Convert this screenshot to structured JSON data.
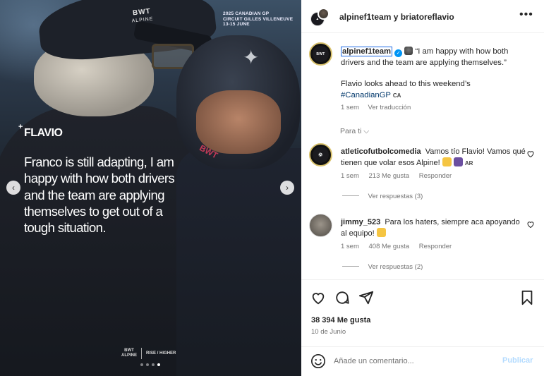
{
  "media": {
    "event_line1": "2025 CANADIAN GP",
    "event_line2": "CIRCUIT GILLES VILLENEUVE",
    "event_line3": "13-15 JUNE",
    "cap_brand": "BWT",
    "cap_team": "ALPINE",
    "sleeve_text": "BWT",
    "tag_label": "FLAVIO",
    "quote": "Franco is still adapting, I am happy with how both drivers and the team are applying themselves to get out of a tough situation.",
    "footer_brand": "BWT",
    "footer_team": "ALPINE",
    "footer_motto": "RISE / HIGHER",
    "prev_icon": "chevron-left-icon",
    "next_icon": "chevron-right-icon",
    "slide_count": 4,
    "active_slide": 4
  },
  "header": {
    "title": "alpinef1team y briatoreflavio",
    "more_icon": "more-horizontal-icon"
  },
  "caption": {
    "username": "alpinef1team",
    "text_line1": "“I am happy with how both drivers and the team are applying themselves.”",
    "text_line2": "Flavio looks ahead to this weekend’s",
    "hashtag": "#CanadianGP",
    "flag": "CA",
    "time": "1 sem",
    "translate": "Ver traducción"
  },
  "para_ti": "Para ti",
  "comments": [
    {
      "username": "atleticofutbolcomedia",
      "text": "Vamos tío Flavio! Vamos qué tienen que volar esos Alpine!",
      "flag": "AR",
      "time": "1 sem",
      "likes": "213 Me gusta",
      "reply": "Responder",
      "replies": "Ver respuestas (3)"
    },
    {
      "username": "jimmy_523",
      "text": "Para los haters, siempre aca apoyando al equipo!",
      "time": "1 sem",
      "likes": "408 Me gusta",
      "reply": "Responder",
      "replies": "Ver respuestas (2)"
    }
  ],
  "actions": {
    "likes": "38 394 Me gusta",
    "date": "10 de Junio"
  },
  "comment_bar": {
    "placeholder": "Añade un comentario...",
    "publish": "Publicar"
  },
  "colors": {
    "accent": "#0095f6",
    "hashtag": "#00376b",
    "muted": "#737373",
    "brand_pink": "#c23a57"
  }
}
